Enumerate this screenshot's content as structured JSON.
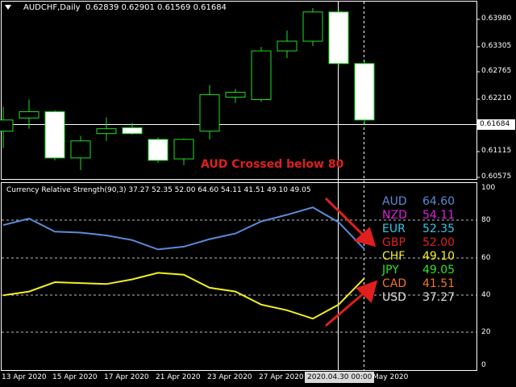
{
  "header": {
    "symbol": "AUDCHF,Daily",
    "ohlc": "0.62839 0.62901 0.61569 0.61684"
  },
  "indicator_header": "Currency Relative Strength(90,3) 37.27 52.35 52.00 64.60 54.11 41.51 49.10 49.05",
  "annotation": "AUD Crossed below 80",
  "price_axis": {
    "ticks": [
      "0.63980",
      "0.63305",
      "0.62765",
      "0.62210",
      "0.61684",
      "0.61115",
      "0.60575"
    ],
    "current_price": "0.61684"
  },
  "indicator_axis": {
    "ticks": [
      "100",
      "80",
      "60",
      "40",
      "20",
      "0"
    ]
  },
  "dates": [
    "13 Apr 2020",
    "15 Apr 2020",
    "17 Apr 2020",
    "21 Apr 2020",
    "23 Apr 2020",
    "27 Apr 2020",
    "2020.04.30 00:00",
    "May 2020"
  ],
  "currencies": [
    {
      "name": "AUD",
      "value": "64.60",
      "color": "#5b8bd6"
    },
    {
      "name": "NZD",
      "value": "54.11",
      "color": "#e020e0"
    },
    {
      "name": "EUR",
      "value": "52.35",
      "color": "#30c8e8"
    },
    {
      "name": "GBP",
      "value": "52.00",
      "color": "#e02020"
    },
    {
      "name": "CHF",
      "value": "49.10",
      "color": "#f0f020"
    },
    {
      "name": "JPY",
      "value": "49.05",
      "color": "#30e030"
    },
    {
      "name": "CAD",
      "value": "41.51",
      "color": "#f07820"
    },
    {
      "name": "USD",
      "value": "37.27",
      "color": "#e0e0e0"
    }
  ],
  "chart_data": [
    {
      "type": "candlestick",
      "symbol": "AUDCHF",
      "ylim": [
        0.605,
        0.6408
      ],
      "candles": [
        {
          "o": 0.6145,
          "h": 0.6195,
          "l": 0.611,
          "c": 0.6168,
          "bull": true
        },
        {
          "o": 0.6172,
          "h": 0.621,
          "l": 0.615,
          "c": 0.6185,
          "bull": true
        },
        {
          "o": 0.6185,
          "h": 0.6188,
          "l": 0.6085,
          "c": 0.609,
          "bull": false
        },
        {
          "o": 0.609,
          "h": 0.6135,
          "l": 0.6065,
          "c": 0.6125,
          "bull": true
        },
        {
          "o": 0.614,
          "h": 0.6173,
          "l": 0.6125,
          "c": 0.615,
          "bull": true
        },
        {
          "o": 0.6152,
          "h": 0.6162,
          "l": 0.6138,
          "c": 0.614,
          "bull": false
        },
        {
          "o": 0.6128,
          "h": 0.6132,
          "l": 0.608,
          "c": 0.6085,
          "bull": false
        },
        {
          "o": 0.6088,
          "h": 0.613,
          "l": 0.6075,
          "c": 0.6128,
          "bull": true
        },
        {
          "o": 0.6145,
          "h": 0.624,
          "l": 0.6128,
          "c": 0.622,
          "bull": true
        },
        {
          "o": 0.6215,
          "h": 0.6232,
          "l": 0.6203,
          "c": 0.6225,
          "bull": true
        },
        {
          "o": 0.621,
          "h": 0.6318,
          "l": 0.6205,
          "c": 0.631,
          "bull": true
        },
        {
          "o": 0.631,
          "h": 0.6352,
          "l": 0.6295,
          "c": 0.633,
          "bull": true
        },
        {
          "o": 0.633,
          "h": 0.6398,
          "l": 0.632,
          "c": 0.639,
          "bull": true
        },
        {
          "o": 0.639,
          "h": 0.6395,
          "l": 0.6275,
          "c": 0.6284,
          "bull": false
        },
        {
          "o": 0.6284,
          "h": 0.629,
          "l": 0.6157,
          "c": 0.6168,
          "bull": false
        }
      ]
    },
    {
      "type": "line",
      "title": "Currency Relative Strength(90,3)",
      "ylim": [
        0,
        100
      ],
      "series": [
        {
          "name": "AUD",
          "color": "#5b8bd6",
          "values": [
            77.5,
            81,
            74,
            73.5,
            72,
            69.5,
            64.5,
            66,
            70,
            73,
            79.5,
            83,
            87,
            79,
            64.6
          ]
        },
        {
          "name": "CHF",
          "color": "#f0f020",
          "values": [
            40,
            42,
            47,
            46.5,
            46,
            48.5,
            52,
            51,
            44,
            42,
            35,
            32,
            27.5,
            35,
            49.1
          ]
        }
      ]
    }
  ]
}
